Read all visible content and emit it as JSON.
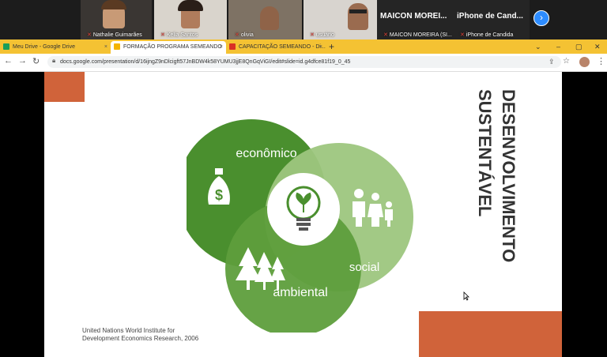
{
  "participants": [
    {
      "name": "Nathalie Guimarães"
    },
    {
      "name": "Kelia Santos"
    },
    {
      "name": "olivia"
    },
    {
      "name": "usuário"
    },
    {
      "name": "MAICON MOREIRA (SI..."
    },
    {
      "name": "iPhone de Candida"
    }
  ],
  "big_names": {
    "maicon": "MAICON MOREI...",
    "iphone": "iPhone de Cand..."
  },
  "tabs": [
    {
      "label": "Meu Drive - Google Drive",
      "icon": "drive-icon",
      "color": "#1a9e5a"
    },
    {
      "label": "FORMAÇÃO PROGRAMA SEMEANDO",
      "icon": "slides-icon",
      "color": "#f4b400"
    },
    {
      "label": "CAPACITAÇÃO SEMEANDO - Di...",
      "icon": "gmail-icon",
      "color": "#d93025"
    }
  ],
  "address": {
    "url": "docs.google.com/presentation/d/16ijngZ9nDlcigft57JnBDW4k58YUMU3jjE8QnGqViGI/edit#slide=id.g4dfce81f19_0_45"
  },
  "slide": {
    "title_line1": "DESENVOLVIMENTO",
    "title_line2": "SUSTENTÁVEL",
    "labels": {
      "economico": "econômico",
      "social": "social",
      "ambiental": "ambiental"
    },
    "source_line1": "United Nations World Institute for",
    "source_line2": "Development Economics Research, 2006",
    "colors": {
      "dark_green": "#4a8f2e",
      "mid_green": "#5e9e3c",
      "light_green": "#9dc67e",
      "accent": "#d0633a"
    }
  }
}
